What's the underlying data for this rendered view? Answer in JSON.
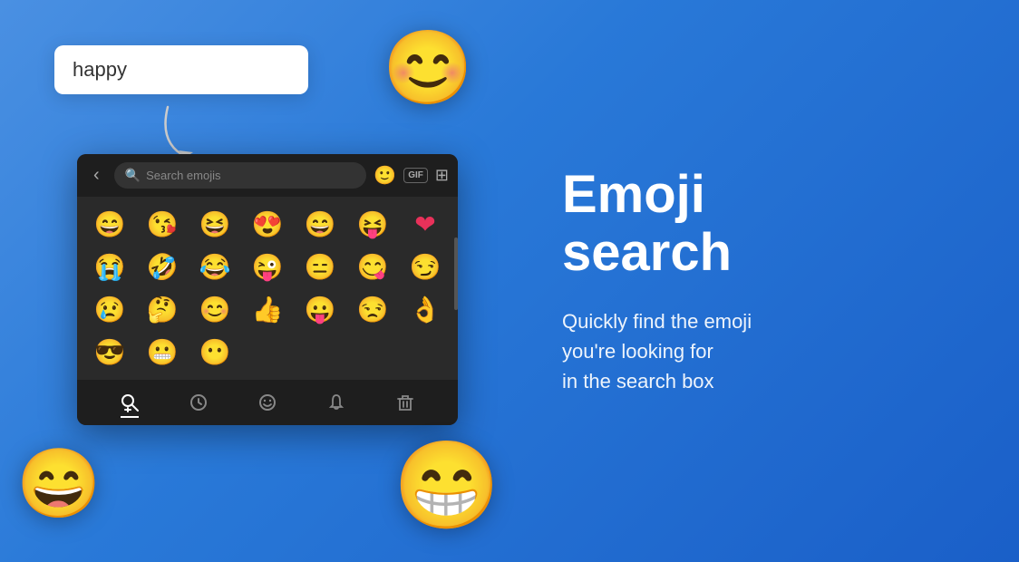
{
  "background": {
    "gradient_start": "#4a90e2",
    "gradient_end": "#1a5fc8"
  },
  "search_card": {
    "value": "happy"
  },
  "keyboard": {
    "search_placeholder": "Search emojis",
    "back_icon": "‹",
    "gif_label": "GIF",
    "emojis_row1": [
      "😄",
      "😘",
      "😆",
      "😍",
      "😄",
      "😝",
      "❤"
    ],
    "emojis_row2": [
      "😭",
      "🤣",
      "😂",
      "😜",
      "😑",
      "😋",
      "😏"
    ],
    "emojis_row3": [
      "😢",
      "🤔",
      "😊",
      "👍",
      "😛",
      "😒",
      "👌"
    ],
    "emojis_row4": [
      "😎",
      "😬",
      "😶"
    ],
    "bottom_nav": [
      "🔍",
      "🕐",
      "😊",
      "🔔",
      "🗑"
    ]
  },
  "headline_line1": "Emoji",
  "headline_line2": "search",
  "subtext_line1": "Quickly find the emoji",
  "subtext_line2": "you're looking for",
  "subtext_line3": "in the search box",
  "decorative_emojis": {
    "top_right": "😊",
    "bottom_right": "😁",
    "bottom_left": "😄"
  }
}
